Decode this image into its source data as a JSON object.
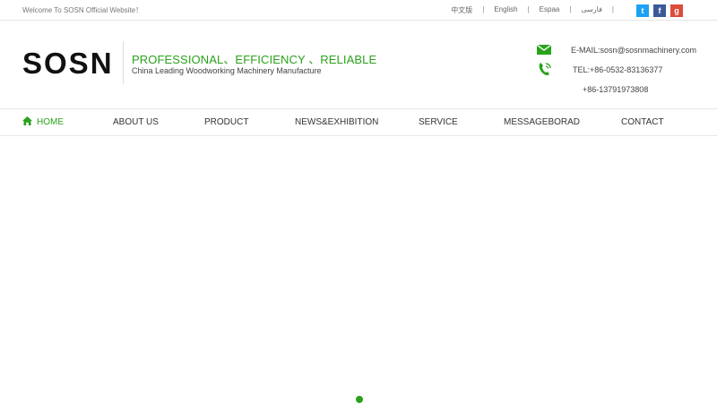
{
  "topbar": {
    "welcome": "Welcome To SOSN Official Website！",
    "languages": [
      "中文版",
      "English",
      "Espaa",
      "فارسی"
    ],
    "separator": "|",
    "socials": [
      {
        "name": "twitter",
        "glyph": "t",
        "color": "#1da1f2"
      },
      {
        "name": "facebook",
        "glyph": "f",
        "color": "#3b5998"
      },
      {
        "name": "google-plus",
        "glyph": "g",
        "color": "#dd4b39"
      }
    ]
  },
  "header": {
    "logo_text": "SOSN",
    "slogan": "PROFESSIONAL、EFFICIENCY 、RELIABLE",
    "tagline": "China Leading Woodworking Machinery Manufacture",
    "email": "E-MAIL:sosn@sosnmachinery.com",
    "tel": "TEL:+86-0532-83136377",
    "tel2": "+86-13791973808"
  },
  "nav": {
    "items": [
      "HOME",
      "ABOUT US",
      "PRODUCT",
      "NEWS&EXHIBITION",
      "SERVICE",
      "MESSAGEBORAD",
      "CONTACT"
    ],
    "active_index": 0
  },
  "colors": {
    "accent": "#2aa21c",
    "text": "#333333",
    "border": "#e6e6e6"
  },
  "icons": {
    "home": "home-icon",
    "mail": "mail-icon",
    "phone": "phone-icon"
  }
}
